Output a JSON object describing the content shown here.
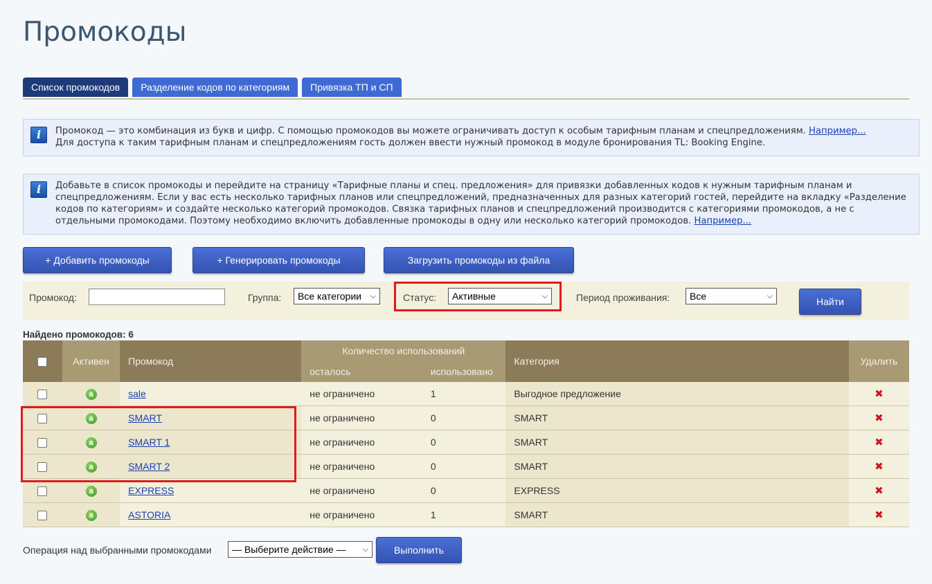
{
  "page": {
    "title": "Промокоды"
  },
  "tabs": [
    {
      "label": "Список промокодов",
      "active": true
    },
    {
      "label": "Разделение кодов по категориям",
      "active": false
    },
    {
      "label": "Привязка ТП и СП",
      "active": false
    }
  ],
  "info1": {
    "text1": "Промокод — это комбинация из букв и цифр. С помощью промокодов вы можете ограничивать доступ к особым тарифным планам и спецпредложениям. ",
    "link": "Например...",
    "text2": "Для доступа к таким тарифным планам и спецпредложениям гость должен ввести нужный промокод в модуле бронирования TL: Booking Engine."
  },
  "info2": {
    "text": "Добавьте в список промокоды и перейдите на страницу «Тарифные планы и спец. предложения» для привязки добавленных кодов к нужным тарифным планам и спецпредложениям. Если у вас есть несколько тарифных планов или спецпредложений, предназначенных для разных категорий гостей, перейдите на вкладку «Разделение кодов по категориям» и создайте несколько категорий промокодов. Связка тарифных планов и спецпредложений производится с категориями промокодов, а не с отдельными промокодами. Поэтому необходимо включить добавленные промокоды в одну или несколько категорий промокодов. ",
    "link": "Например..."
  },
  "actions": {
    "add": "+ Добавить промокоды",
    "generate": "+ Генерировать промокоды",
    "upload": "Загрузить промокоды из файла"
  },
  "filters": {
    "promo_label": "Промокод:",
    "promo_value": "",
    "group_label": "Группа:",
    "group_value": "Все категории",
    "status_label": "Статус:",
    "status_value": "Активные",
    "period_label": "Период проживания:",
    "period_value": "Все",
    "find_button": "Найти"
  },
  "found_text": "Найдено промокодов: 6",
  "table": {
    "headers": {
      "active": "Активен",
      "code": "Промокод",
      "usage": "Количество использований",
      "remaining": "осталось",
      "used": "использовано",
      "category": "Категория",
      "delete": "Удалить"
    },
    "active_glyph": "a",
    "delete_glyph": "✖",
    "rows": [
      {
        "code": "sale",
        "remaining": "не ограничено",
        "used": "1",
        "category": "Выгодное предложение"
      },
      {
        "code": "SMART",
        "remaining": "не ограничено",
        "used": "0",
        "category": "SMART"
      },
      {
        "code": "SMART 1",
        "remaining": "не ограничено",
        "used": "0",
        "category": "SMART"
      },
      {
        "code": "SMART 2",
        "remaining": "не ограничено",
        "used": "0",
        "category": "SMART"
      },
      {
        "code": "EXPRESS",
        "remaining": "не ограничено",
        "used": "0",
        "category": "EXPRESS"
      },
      {
        "code": "ASTORIA",
        "remaining": "не ограничено",
        "used": "1",
        "category": "SMART"
      }
    ]
  },
  "bulk": {
    "label": "Операция над выбранными промокодами",
    "select_value": "— Выберите действие —",
    "execute": "Выполнить"
  },
  "colors": {
    "tab_active": "#1d3a7b",
    "tab": "#3f6ad3",
    "button": "#3f5fc4",
    "header_dark": "#8b7b58",
    "header_light": "#a89a73",
    "highlight": "#e01a1a",
    "delete": "#d0141e"
  }
}
